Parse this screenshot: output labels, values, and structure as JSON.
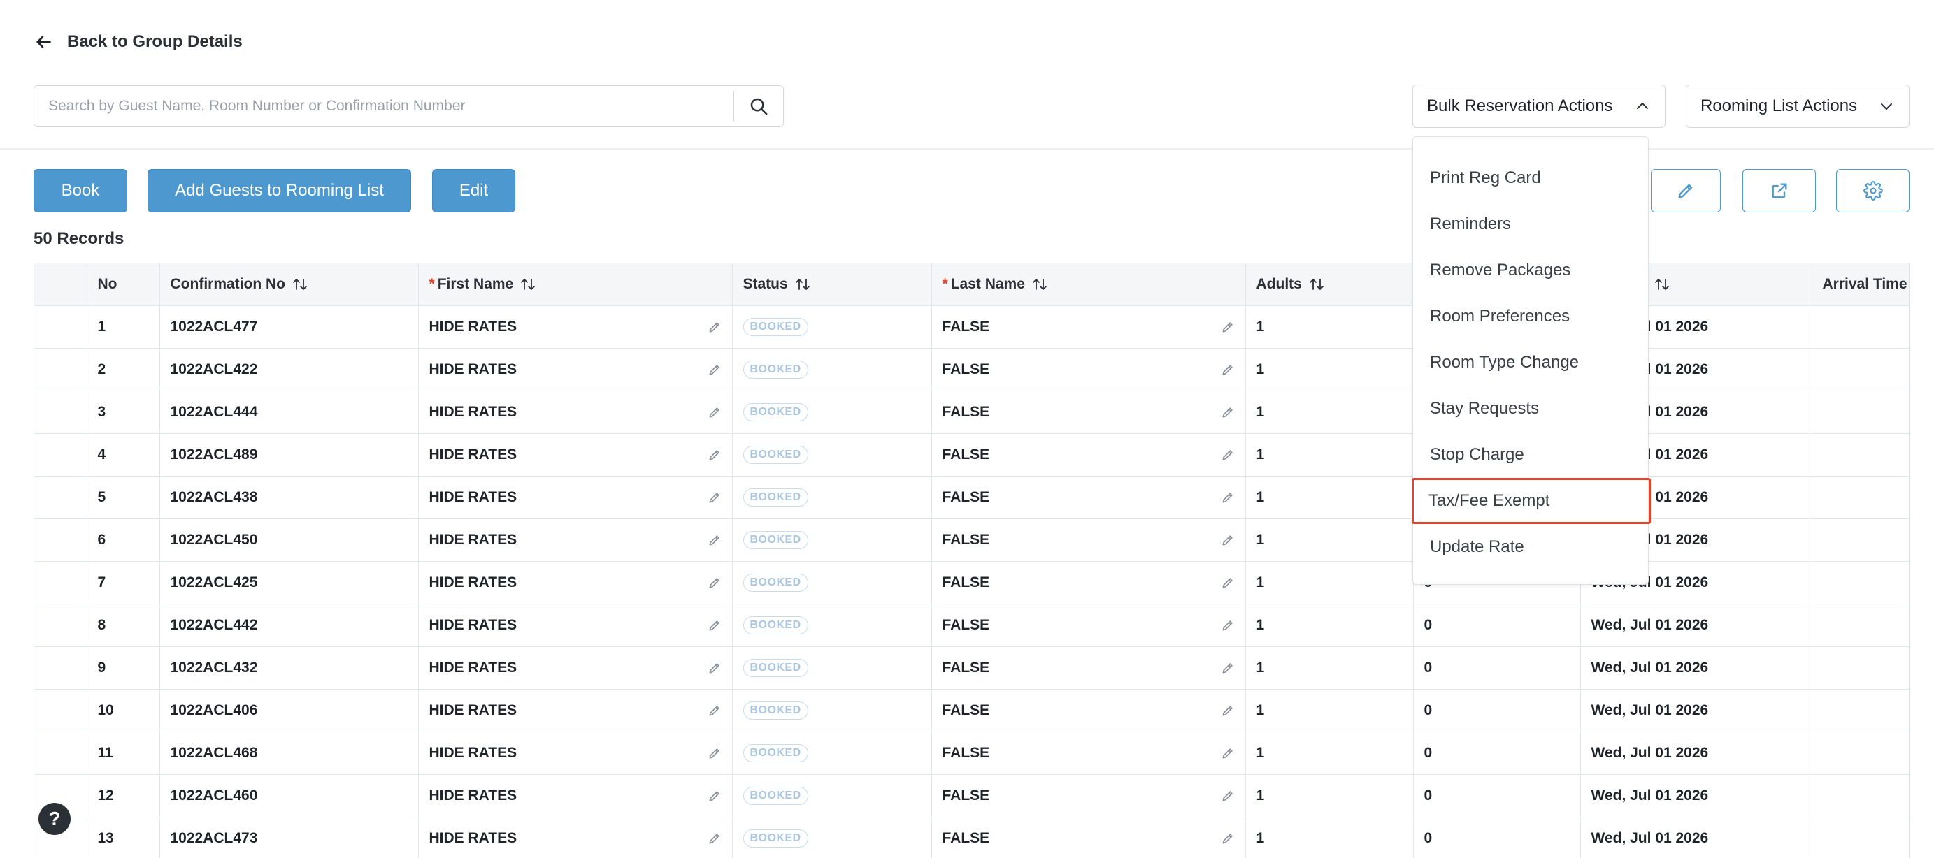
{
  "back_link": "Back to Group Details",
  "search": {
    "placeholder": "Search by Guest Name, Room Number or Confirmation Number",
    "value": ""
  },
  "dropdowns": {
    "bulk": "Bulk Reservation Actions",
    "rooming": "Rooming List Actions"
  },
  "buttons": {
    "book": "Book",
    "add_guests": "Add Guests to Rooming List",
    "edit": "Edit"
  },
  "records": "50 Records",
  "columns": [
    "",
    "No",
    "Confirmation No",
    "First Name",
    "Status",
    "Last Name",
    "Adults",
    "",
    "",
    "Arrival Time"
  ],
  "rows": [
    {
      "no": "1",
      "conf": "1022ACL477",
      "first": "HIDE RATES",
      "status": "BOOKED",
      "last": "FALSE",
      "adults": "1",
      "children": "",
      "arrival": "Wed, Jul 01 2026"
    },
    {
      "no": "2",
      "conf": "1022ACL422",
      "first": "HIDE RATES",
      "status": "BOOKED",
      "last": "FALSE",
      "adults": "1",
      "children": "",
      "arrival": "Wed, Jul 01 2026"
    },
    {
      "no": "3",
      "conf": "1022ACL444",
      "first": "HIDE RATES",
      "status": "BOOKED",
      "last": "FALSE",
      "adults": "1",
      "children": "",
      "arrival": "Wed, Jul 01 2026"
    },
    {
      "no": "4",
      "conf": "1022ACL489",
      "first": "HIDE RATES",
      "status": "BOOKED",
      "last": "FALSE",
      "adults": "1",
      "children": "",
      "arrival": "Wed, Jul 01 2026"
    },
    {
      "no": "5",
      "conf": "1022ACL438",
      "first": "HIDE RATES",
      "status": "BOOKED",
      "last": "FALSE",
      "adults": "1",
      "children": "",
      "arrival": "Wed, Jul 01 2026"
    },
    {
      "no": "6",
      "conf": "1022ACL450",
      "first": "HIDE RATES",
      "status": "BOOKED",
      "last": "FALSE",
      "adults": "1",
      "children": "",
      "arrival": "Wed, Jul 01 2026"
    },
    {
      "no": "7",
      "conf": "1022ACL425",
      "first": "HIDE RATES",
      "status": "BOOKED",
      "last": "FALSE",
      "adults": "1",
      "children": "0",
      "arrival": "Wed, Jul 01 2026"
    },
    {
      "no": "8",
      "conf": "1022ACL442",
      "first": "HIDE RATES",
      "status": "BOOKED",
      "last": "FALSE",
      "adults": "1",
      "children": "0",
      "arrival": "Wed, Jul 01 2026"
    },
    {
      "no": "9",
      "conf": "1022ACL432",
      "first": "HIDE RATES",
      "status": "BOOKED",
      "last": "FALSE",
      "adults": "1",
      "children": "0",
      "arrival": "Wed, Jul 01 2026"
    },
    {
      "no": "10",
      "conf": "1022ACL406",
      "first": "HIDE RATES",
      "status": "BOOKED",
      "last": "FALSE",
      "adults": "1",
      "children": "0",
      "arrival": "Wed, Jul 01 2026"
    },
    {
      "no": "11",
      "conf": "1022ACL468",
      "first": "HIDE RATES",
      "status": "BOOKED",
      "last": "FALSE",
      "adults": "1",
      "children": "0",
      "arrival": "Wed, Jul 01 2026"
    },
    {
      "no": "12",
      "conf": "1022ACL460",
      "first": "HIDE RATES",
      "status": "BOOKED",
      "last": "FALSE",
      "adults": "1",
      "children": "0",
      "arrival": "Wed, Jul 01 2026"
    },
    {
      "no": "13",
      "conf": "1022ACL473",
      "first": "HIDE RATES",
      "status": "BOOKED",
      "last": "FALSE",
      "adults": "1",
      "children": "0",
      "arrival": "Wed, Jul 01 2026"
    }
  ],
  "menu": [
    "Print Reg Card",
    "Reminders",
    "Remove Packages",
    "Room Preferences",
    "Room Type Change",
    "Stay Requests",
    "Stop Charge",
    "Tax/Fee Exempt",
    "Update Rate"
  ],
  "menu_highlighted": "Tax/Fee Exempt",
  "help": "?",
  "colors": {
    "primary": "#4c98cf",
    "highlight": "#e0452f",
    "required": "#e0452f"
  }
}
